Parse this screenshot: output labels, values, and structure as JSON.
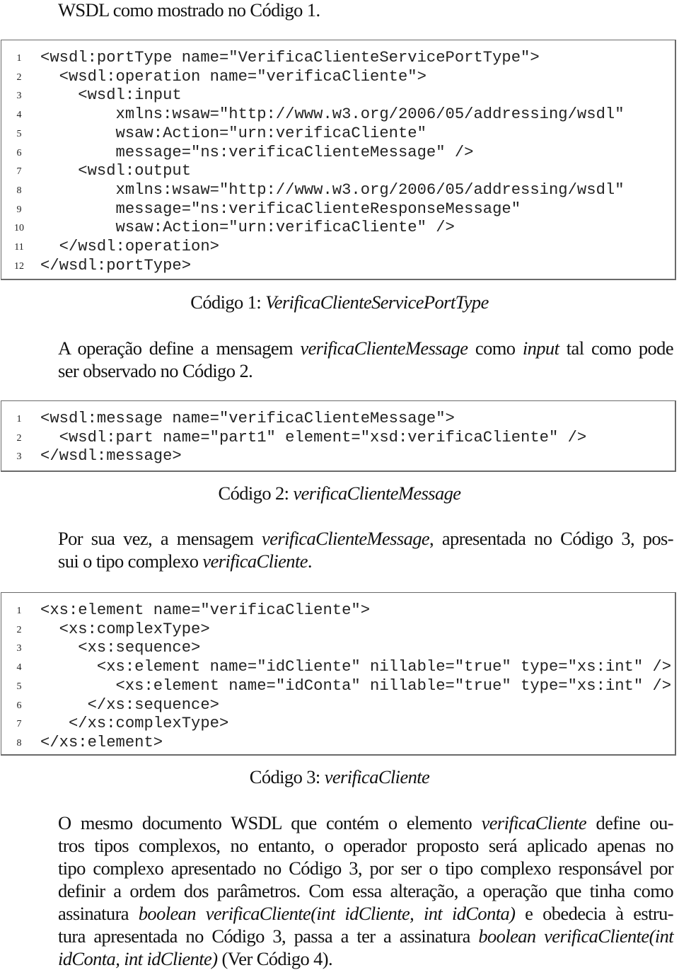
{
  "intro_line": "WSDL como mostrado no Código 1.",
  "code_blocks": [
    {
      "lines": [
        {
          "n": "1",
          "text": "<wsdl:portType name=\"VerificaClienteServicePortType\">"
        },
        {
          "n": "2",
          "text": "  <wsdl:operation name=\"verificaCliente\">"
        },
        {
          "n": "3",
          "text": "    <wsdl:input"
        },
        {
          "n": "4",
          "text": "        xmlns:wsaw=\"http://www.w3.org/2006/05/addressing/wsdl\""
        },
        {
          "n": "5",
          "text": "        wsaw:Action=\"urn:verificaCliente\""
        },
        {
          "n": "6",
          "text": "        message=\"ns:verificaClienteMessage\" />"
        },
        {
          "n": "7",
          "text": "    <wsdl:output"
        },
        {
          "n": "8",
          "text": "        xmlns:wsaw=\"http://www.w3.org/2006/05/addressing/wsdl\""
        },
        {
          "n": "9",
          "text": "        message=\"ns:verificaClienteResponseMessage\""
        },
        {
          "n": "10",
          "text": "        wsaw:Action=\"urn:verificaCliente\" />"
        },
        {
          "n": "11",
          "text": "  </wsdl:operation>"
        },
        {
          "n": "12",
          "text": "</wsdl:portType>"
        }
      ],
      "caption_prefix": "Código 1: ",
      "caption_name": "VerificaClienteServicePortType"
    },
    {
      "lines": [
        {
          "n": "1",
          "text": "<wsdl:message name=\"verificaClienteMessage\">"
        },
        {
          "n": "2",
          "text": "  <wsdl:part name=\"part1\" element=\"xsd:verificaCliente\" />"
        },
        {
          "n": "3",
          "text": "</wsdl:message>"
        }
      ],
      "caption_prefix": "Código 2: ",
      "caption_name": "verificaClienteMessage"
    },
    {
      "lines": [
        {
          "n": "1",
          "text": "<xs:element name=\"verificaCliente\">"
        },
        {
          "n": "2",
          "text": "  <xs:complexType>"
        },
        {
          "n": "3",
          "text": "    <xs:sequence>"
        },
        {
          "n": "4",
          "text": "      <xs:element name=\"idCliente\" nillable=\"true\" type=\"xs:int\" />"
        },
        {
          "n": "5",
          "text": "        <xs:element name=\"idConta\" nillable=\"true\" type=\"xs:int\" />"
        },
        {
          "n": "6",
          "text": "     </xs:sequence>"
        },
        {
          "n": "7",
          "text": "   </xs:complexType>"
        },
        {
          "n": "8",
          "text": "</xs:element>"
        }
      ],
      "caption_prefix": "Código 3: ",
      "caption_name": "verificaCliente"
    }
  ],
  "paragraphs": {
    "p1": {
      "l1_a": "A operação define a mensagem ",
      "l1_b": "verificaClienteMessage",
      "l1_c": " como ",
      "l1_d": "input",
      "l1_e": " tal como pode",
      "l2": "ser observado no Código  2."
    },
    "p2": {
      "l1_a": "Por sua vez, a mensagem ",
      "l1_b": "verificaClienteMessage",
      "l1_c": ", apresentada no Código  3, pos-",
      "l2_a": "sui o tipo complexo ",
      "l2_b": "verificaCliente",
      "l2_c": "."
    },
    "p3": {
      "l1_a": "O mesmo documento WSDL que contém o elemento ",
      "l1_b": "verificaCliente",
      "l1_c": " define ou-",
      "l2": "tros tipos complexos, no entanto, o operador proposto será aplicado apenas no",
      "l3": "tipo complexo apresentado no Código 3, por ser o tipo complexo responsável por",
      "l4": "definir a ordem dos parâmetros.  Com essa alteração, a operação que tinha como",
      "l5_a": "assinatura ",
      "l5_b": "boolean verificaCliente(int idCliente, int idConta)",
      "l5_c": " e obedecia à estru-",
      "l6_a": "tura apresentada no Código 3, passa a ter a assinatura ",
      "l6_b": "boolean verificaCliente(int",
      "l7_a": "idConta, int idCliente)",
      "l7_b": " (Ver Código  4)."
    }
  }
}
